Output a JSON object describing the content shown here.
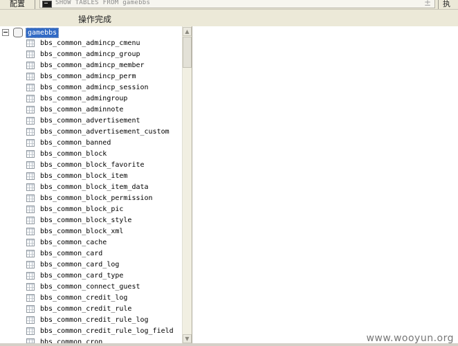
{
  "toolbar": {
    "config_label": "配置",
    "sql_text": "SHOW TABLES FROM  gamebbs",
    "add_glyph": "±",
    "exec_label": "执"
  },
  "status": {
    "message": "操作完成"
  },
  "tree": {
    "root": {
      "label": "gamebbs",
      "icon": "database-icon",
      "expanded": true
    },
    "items": [
      "bbs_common_admincp_cmenu",
      "bbs_common_admincp_group",
      "bbs_common_admincp_member",
      "bbs_common_admincp_perm",
      "bbs_common_admincp_session",
      "bbs_common_admingroup",
      "bbs_common_adminnote",
      "bbs_common_advertisement",
      "bbs_common_advertisement_custom",
      "bbs_common_banned",
      "bbs_common_block",
      "bbs_common_block_favorite",
      "bbs_common_block_item",
      "bbs_common_block_item_data",
      "bbs_common_block_permission",
      "bbs_common_block_pic",
      "bbs_common_block_style",
      "bbs_common_block_xml",
      "bbs_common_cache",
      "bbs_common_card",
      "bbs_common_card_log",
      "bbs_common_card_type",
      "bbs_common_connect_guest",
      "bbs_common_credit_log",
      "bbs_common_credit_rule",
      "bbs_common_credit_rule_log",
      "bbs_common_credit_rule_log_field",
      "bbs_common_cron"
    ]
  },
  "scrollbar": {
    "up_glyph": "▲",
    "down_glyph": "▼"
  },
  "watermark": "www.wooyun.org",
  "colors": {
    "selection": "#316ac5",
    "chrome": "#ece9d8"
  }
}
